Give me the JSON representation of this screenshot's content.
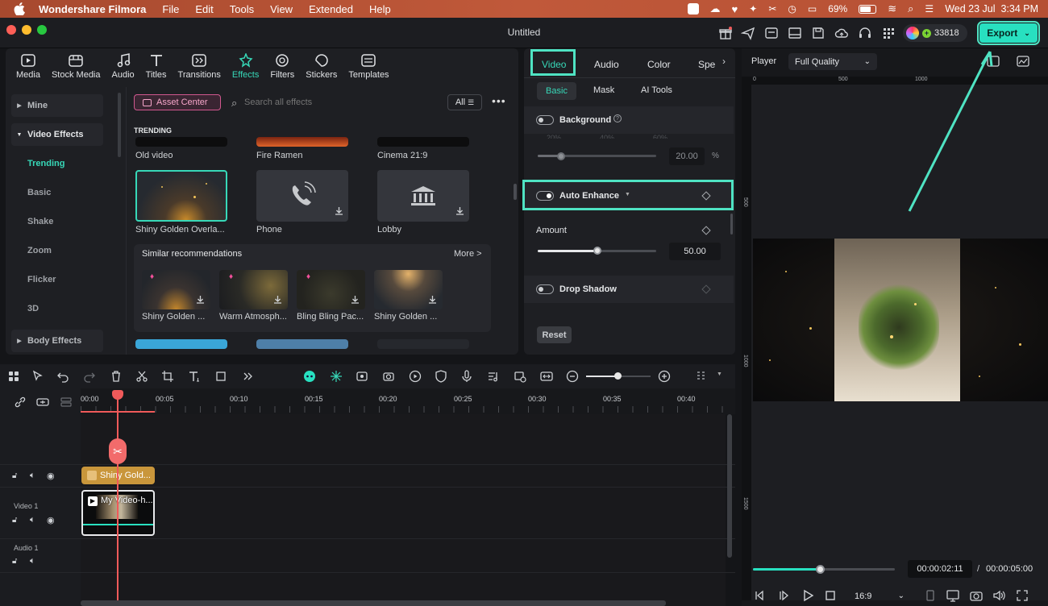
{
  "menubar": {
    "app_name": "Wondershare Filmora",
    "items": [
      "File",
      "Edit",
      "Tools",
      "View",
      "Extended",
      "Help"
    ],
    "battery": "69%",
    "datetime": "Wed 23 Jul  3:34 PM"
  },
  "window": {
    "title": "Untitled",
    "credits": "33818",
    "export_label": "Export"
  },
  "media_tabs": [
    {
      "label": "Media",
      "icon": "media-icon"
    },
    {
      "label": "Stock Media",
      "icon": "stock-media-icon"
    },
    {
      "label": "Audio",
      "icon": "music-note-icon"
    },
    {
      "label": "Titles",
      "icon": "titles-icon"
    },
    {
      "label": "Transitions",
      "icon": "transitions-icon"
    },
    {
      "label": "Effects",
      "icon": "effects-icon"
    },
    {
      "label": "Filters",
      "icon": "filters-icon"
    },
    {
      "label": "Stickers",
      "icon": "stickers-icon"
    },
    {
      "label": "Templates",
      "icon": "templates-icon"
    }
  ],
  "sidebar": {
    "mine": "Mine",
    "video_effects": "Video Effects",
    "subitems": [
      "Trending",
      "Basic",
      "Shake",
      "Zoom",
      "Flicker",
      "3D"
    ],
    "body_effects": "Body Effects"
  },
  "effects": {
    "asset_center": "Asset Center",
    "search_placeholder": "Search all effects",
    "filter": "All",
    "section": "TRENDING",
    "row1": [
      "Old video",
      "Fire Ramen",
      "Cinema 21:9"
    ],
    "row2": [
      "Shiny Golden Overla...",
      "Phone",
      "Lobby"
    ],
    "similar_title": "Similar recommendations",
    "more": "More >",
    "similar": [
      "Shiny Golden ...",
      "Warm Atmosph...",
      "Bling Bling Pac...",
      "Shiny Golden ..."
    ]
  },
  "props": {
    "tabs": [
      "Video",
      "Audio",
      "Color",
      "Spe"
    ],
    "subtabs": [
      "Basic",
      "Mask",
      "AI Tools"
    ],
    "background": "Background",
    "bg_pcts": [
      "20%",
      "40%",
      "60%"
    ],
    "bg_value": "20.00",
    "bg_unit": "%",
    "bg_level": 0.2,
    "auto_enhance": "Auto Enhance",
    "amount": "Amount",
    "amount_value": "50.00",
    "amount_level": 0.5,
    "drop_shadow": "Drop Shadow",
    "reset": "Reset"
  },
  "timeline": {
    "ticks": [
      "00:00",
      "00:05",
      "00:10",
      "00:15",
      "00:20",
      "00:25",
      "00:30",
      "00:35",
      "00:40"
    ],
    "tracks": [
      "Video 1",
      "Audio 1"
    ],
    "effect_clip": "Shiny Gold...",
    "video_clip": "My Video-h..."
  },
  "player": {
    "label": "Player",
    "quality": "Full Quality",
    "ruler_x": [
      "0",
      "500",
      "1000"
    ],
    "ruler_y": [
      "500",
      "1000",
      "1500"
    ],
    "current_time": "00:00:02:11",
    "separator": "/",
    "total_time": "00:00:05:00",
    "progress": 0.47,
    "aspect": "16:9"
  },
  "colors": {
    "accent": "#28e0c0",
    "playhead": "#f05a5a",
    "effect_clip": "#c9963b"
  }
}
